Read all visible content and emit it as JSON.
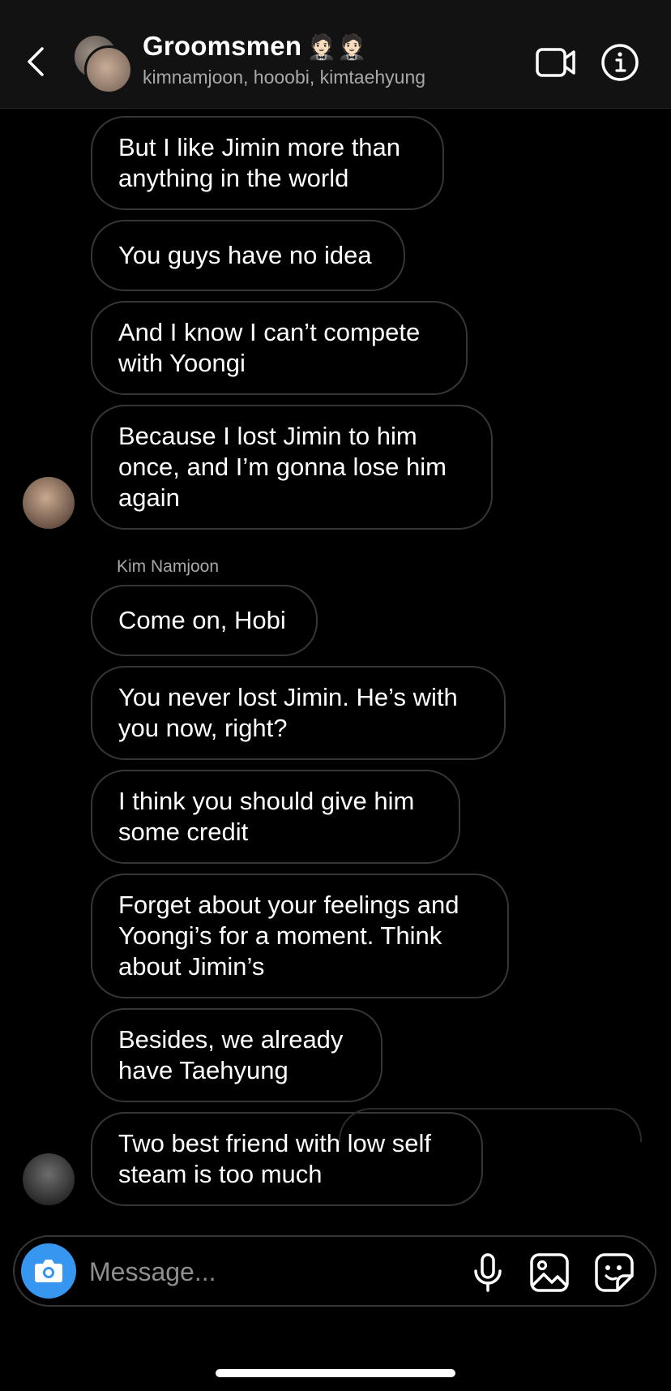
{
  "header": {
    "title": "Groomsmen",
    "title_emoji": "🤵🏻🤵🏻",
    "subtitle": "kimnamjoon, hooobi, kimtaehyung"
  },
  "messages": [
    {
      "text": "But I like Jimin more than anything in the world"
    },
    {
      "text": "You guys have no idea"
    },
    {
      "text": "And I know I can’t compete with Yoongi"
    },
    {
      "text": "Because I lost Jimin to him once, and I’m gonna lose him again"
    },
    {
      "sender": "Kim Namjoon",
      "text": "Come on, Hobi"
    },
    {
      "text": "You never lost Jimin. He’s with you now, right?"
    },
    {
      "text": "I think you should give him some credit"
    },
    {
      "text": "Forget about your feelings and Yoongi’s for a moment. Think about Jimin’s"
    },
    {
      "text": "Besides, we already have Taehyung"
    },
    {
      "text": "Two best friend with low self steam is too much"
    }
  ],
  "composer": {
    "placeholder": "Message..."
  },
  "colors": {
    "accent": "#3797f0",
    "bubble_border": "#363636",
    "header_bg": "#121212"
  },
  "icons": [
    "back-chevron-icon",
    "video-camera-icon",
    "info-icon",
    "camera-icon",
    "microphone-icon",
    "gallery-icon",
    "sticker-icon"
  ]
}
